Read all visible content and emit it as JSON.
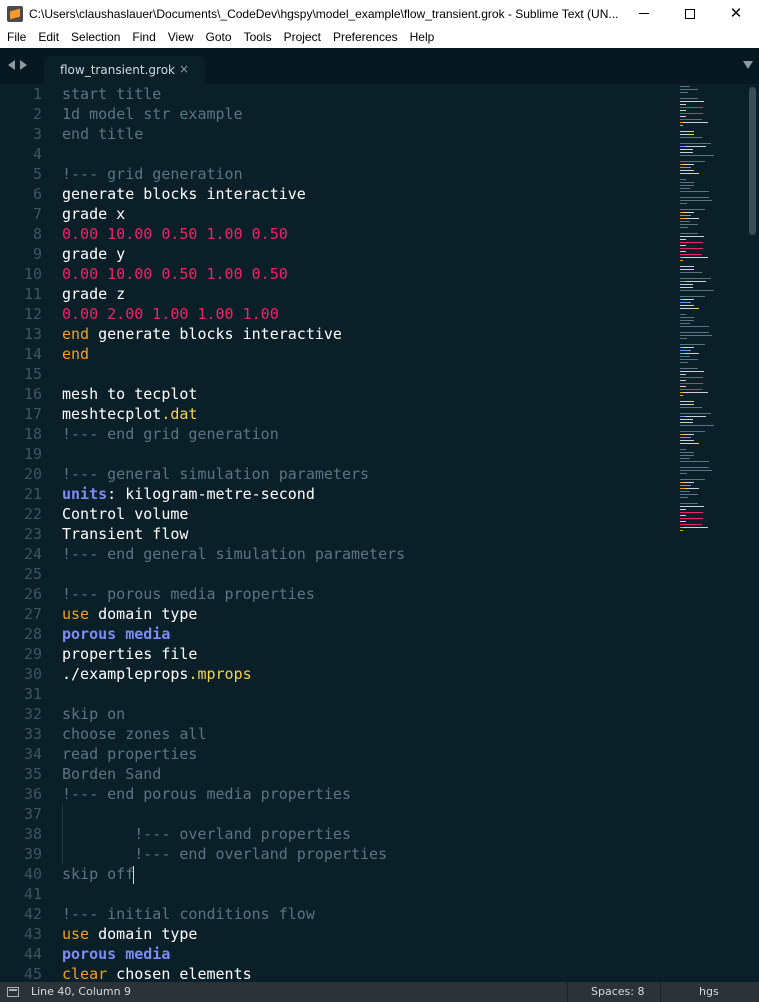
{
  "window": {
    "title": "C:\\Users\\claushaslauer\\Documents\\_CodeDev\\hgspy\\model_example\\flow_transient.grok - Sublime Text (UN...",
    "minimize_icon": "minimize-icon",
    "maximize_icon": "maximize-icon",
    "close_icon": "close-icon"
  },
  "menu": [
    "File",
    "Edit",
    "Selection",
    "Find",
    "View",
    "Goto",
    "Tools",
    "Project",
    "Preferences",
    "Help"
  ],
  "tabs": [
    {
      "label": "flow_transient.grok",
      "close_glyph": "×"
    }
  ],
  "editor": {
    "lines": [
      {
        "n": "1",
        "tokens": [
          [
            "start title",
            "comment"
          ]
        ]
      },
      {
        "n": "2",
        "tokens": [
          [
            "1d model str example",
            "comment"
          ]
        ]
      },
      {
        "n": "3",
        "tokens": [
          [
            "end title",
            "comment"
          ]
        ]
      },
      {
        "n": "4",
        "tokens": []
      },
      {
        "n": "5",
        "tokens": [
          [
            "!--- grid generation",
            "comment"
          ]
        ]
      },
      {
        "n": "6",
        "tokens": [
          [
            "generate blocks interactive",
            "white"
          ]
        ]
      },
      {
        "n": "7",
        "tokens": [
          [
            "grade x",
            "white"
          ]
        ]
      },
      {
        "n": "8",
        "tokens": [
          [
            "0.00 10.00 0.50 1.00 0.50",
            "num"
          ]
        ]
      },
      {
        "n": "9",
        "tokens": [
          [
            "grade y",
            "white"
          ]
        ]
      },
      {
        "n": "10",
        "tokens": [
          [
            "0.00 10.00 0.50 1.00 0.50",
            "num"
          ]
        ]
      },
      {
        "n": "11",
        "tokens": [
          [
            "grade z",
            "white"
          ]
        ]
      },
      {
        "n": "12",
        "tokens": [
          [
            "0.00 2.00 1.00 1.00 1.00",
            "num"
          ]
        ]
      },
      {
        "n": "13",
        "tokens": [
          [
            "end",
            "kw"
          ],
          [
            " generate blocks interactive",
            "white"
          ]
        ]
      },
      {
        "n": "14",
        "tokens": [
          [
            "end",
            "kw"
          ]
        ]
      },
      {
        "n": "15",
        "tokens": []
      },
      {
        "n": "16",
        "tokens": [
          [
            "mesh to tecplot",
            "white"
          ]
        ]
      },
      {
        "n": "17",
        "tokens": [
          [
            "meshtecplot",
            "white"
          ],
          [
            ".dat",
            "yellow"
          ]
        ]
      },
      {
        "n": "18",
        "tokens": [
          [
            "!--- end grid generation",
            "comment"
          ]
        ]
      },
      {
        "n": "19",
        "tokens": []
      },
      {
        "n": "20",
        "tokens": [
          [
            "!--- general simulation parameters",
            "comment"
          ]
        ]
      },
      {
        "n": "21",
        "tokens": [
          [
            "units",
            "blue"
          ],
          [
            ": kilogram-metre-second",
            "white"
          ]
        ]
      },
      {
        "n": "22",
        "tokens": [
          [
            "Control volume",
            "white"
          ]
        ]
      },
      {
        "n": "23",
        "tokens": [
          [
            "Transient flow",
            "white"
          ]
        ]
      },
      {
        "n": "24",
        "tokens": [
          [
            "!--- end general simulation parameters",
            "comment"
          ]
        ]
      },
      {
        "n": "25",
        "tokens": []
      },
      {
        "n": "26",
        "tokens": [
          [
            "!--- porous media properties",
            "comment"
          ]
        ]
      },
      {
        "n": "27",
        "tokens": [
          [
            "use",
            "kw"
          ],
          [
            " domain type",
            "white"
          ]
        ]
      },
      {
        "n": "28",
        "tokens": [
          [
            "porous media",
            "blue"
          ]
        ]
      },
      {
        "n": "29",
        "tokens": [
          [
            "properties file",
            "white"
          ]
        ]
      },
      {
        "n": "30",
        "tokens": [
          [
            "./exampleprops",
            "white"
          ],
          [
            ".mprops",
            "yellow"
          ]
        ]
      },
      {
        "n": "31",
        "tokens": []
      },
      {
        "n": "32",
        "tokens": [
          [
            "skip on",
            "comment"
          ]
        ]
      },
      {
        "n": "33",
        "tokens": [
          [
            "choose zones all",
            "comment"
          ]
        ]
      },
      {
        "n": "34",
        "tokens": [
          [
            "read properties",
            "comment"
          ]
        ]
      },
      {
        "n": "35",
        "tokens": [
          [
            "Borden Sand",
            "comment"
          ]
        ]
      },
      {
        "n": "36",
        "tokens": [
          [
            "!--- end porous media properties",
            "comment"
          ]
        ]
      },
      {
        "n": "37",
        "tokens": []
      },
      {
        "n": "38",
        "tokens": [
          [
            "        !--- overland properties",
            "comment"
          ]
        ]
      },
      {
        "n": "39",
        "tokens": [
          [
            "        !--- end overland properties",
            "comment"
          ]
        ]
      },
      {
        "n": "40",
        "tokens": [
          [
            "skip off",
            "comment"
          ]
        ]
      },
      {
        "n": "41",
        "tokens": []
      },
      {
        "n": "42",
        "tokens": [
          [
            "!--- initial conditions flow",
            "comment"
          ]
        ]
      },
      {
        "n": "43",
        "tokens": [
          [
            "use",
            "kw"
          ],
          [
            " domain type",
            "white"
          ]
        ]
      },
      {
        "n": "44",
        "tokens": [
          [
            "porous media",
            "blue"
          ]
        ]
      },
      {
        "n": "45",
        "tokens": [
          [
            "clear",
            "kw"
          ],
          [
            " chosen elements",
            "white"
          ]
        ]
      }
    ]
  },
  "status": {
    "position": "Line 40, Column 9",
    "spaces": "Spaces: 8",
    "syntax": "hgs"
  },
  "colors": {
    "background": "#0a1f28",
    "comment": "#5a7582",
    "number": "#f2226a",
    "keyword": "#f6a01b",
    "builtin": "#7f8cf5",
    "extension": "#f3d44c"
  }
}
